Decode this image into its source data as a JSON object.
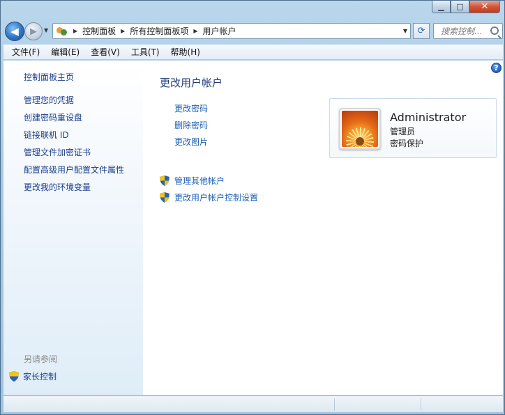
{
  "window": {
    "caption": {
      "minimize": "▁",
      "maximize": "□",
      "close": "✕"
    }
  },
  "nav": {
    "back_glyph": "◀",
    "forward_glyph": "▶",
    "breadcrumbs": [
      "控制面板",
      "所有控制面板项",
      "用户帐户"
    ],
    "search_placeholder": "搜索控制...",
    "icons": [
      "back-arrow-icon",
      "forward-arrow-icon",
      "control-panel-icon",
      "refresh-icon",
      "search-icon"
    ]
  },
  "menu": {
    "items": [
      "文件(F)",
      "编辑(E)",
      "查看(V)",
      "工具(T)",
      "帮助(H)"
    ]
  },
  "sidebar": {
    "home": "控制面板主页",
    "links": [
      "管理您的凭据",
      "创建密码重设盘",
      "链接联机 ID",
      "管理文件加密证书",
      "配置高级用户配置文件属性",
      "更改我的环境变量"
    ],
    "see_also": "另请参阅",
    "parental": "家长控制"
  },
  "main": {
    "help_glyph": "?",
    "title": "更改用户帐户",
    "links": [
      "更改密码",
      "删除密码",
      "更改图片"
    ],
    "admin_links": [
      "管理其他帐户",
      "更改用户帐户控制设置"
    ]
  },
  "user": {
    "name": "Administrator",
    "role": "管理员",
    "status": "密码保护"
  },
  "colors": {
    "link": "#1a5fb4",
    "sidebar_link": "#1a3e8c",
    "title": "#1f3b7a",
    "window_frame": "#a7c9e4"
  }
}
